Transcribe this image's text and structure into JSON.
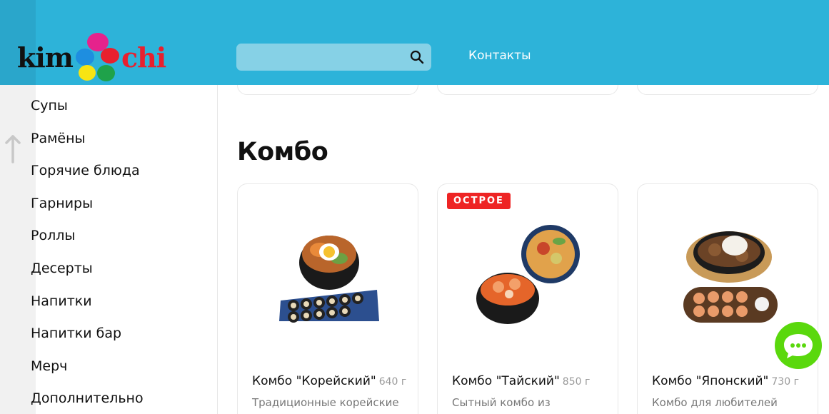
{
  "header": {
    "logo": {
      "left_word": "kim",
      "right_word": "chi"
    },
    "search": {
      "placeholder": "",
      "icon": "search-icon"
    },
    "nav": {
      "contacts": "Контакты"
    }
  },
  "sidebar": {
    "scroll_up_icon": "arrow-up-icon",
    "items": [
      "Супы",
      "Рамёны",
      "Горячие блюда",
      "Гарниры",
      "Роллы",
      "Десерты",
      "Напитки",
      "Напитки бар",
      "Мерч",
      "Дополнительно"
    ]
  },
  "main": {
    "section_title": "Комбо",
    "cards": [
      {
        "name": "Комбо \"Корейский\"",
        "weight": "640 г",
        "badge": "",
        "description": "Традиционные корейские"
      },
      {
        "name": "Комбо \"Тайский\"",
        "weight": "850 г",
        "badge": "ОСТРОЕ",
        "description": "Сытный комбо из"
      },
      {
        "name": "Комбо \"Японский\"",
        "weight": "730 г",
        "badge": "",
        "description": "Комбо для любителей"
      }
    ]
  },
  "chat_button": {
    "icon": "chat-bubble-icon"
  },
  "colors": {
    "header_bg": "#2db3d9",
    "badge_bg": "#ee2424",
    "chat_bg": "#5ad80d",
    "logo_chi": "#e8202e"
  }
}
